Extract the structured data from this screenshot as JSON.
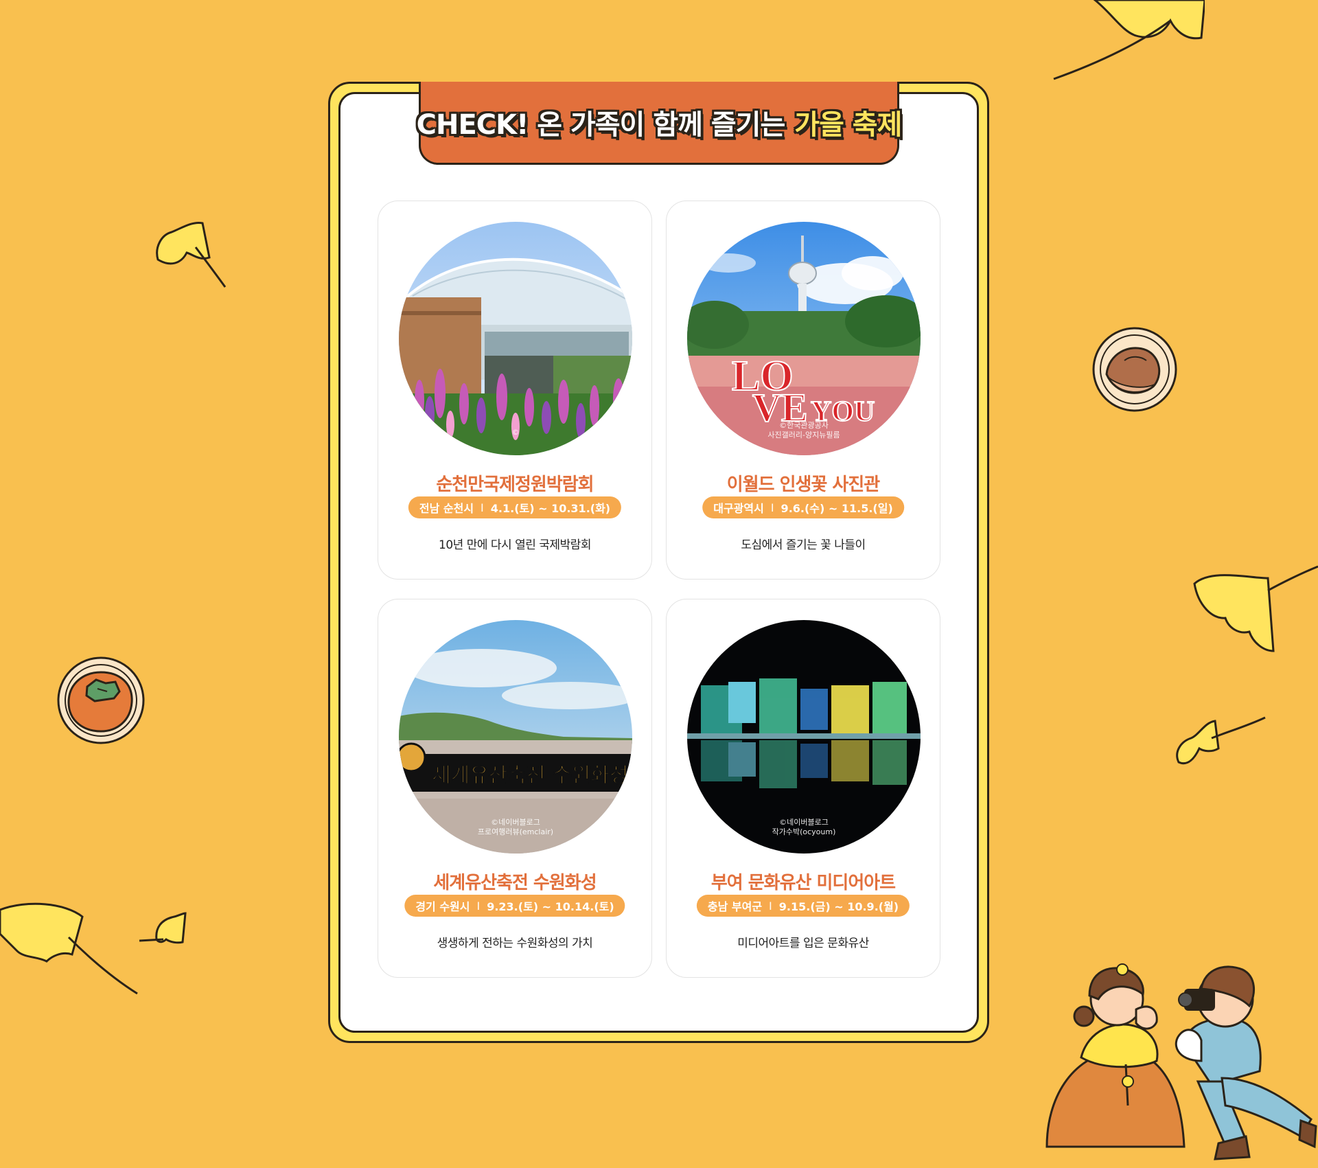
{
  "header": {
    "title_prefix": "CHECK! 온 가족이 함께 즐기는",
    "title_highlight": "가을 축제"
  },
  "cards": [
    {
      "title": "순천만국제정원박람회",
      "region": "전남 순천시",
      "period": "4.1.(토) ~ 10.31.(화)",
      "description": "10년 만에 다시 열린 국제박람회",
      "credit_1": "©",
      "credit_2": ""
    },
    {
      "title": "이월드 인생꽃 사진관",
      "region": "대구광역시",
      "period": "9.6.(수) ~ 11.5.(일)",
      "description": "도심에서 즐기는 꽃 나들이",
      "credit_1": "©한국관광공사",
      "credit_2": "사진갤러리-양지뉴필름",
      "sign_text": "LOVE YOU"
    },
    {
      "title": "세계유산축전 수원화성",
      "region": "경기 수원시",
      "period": "9.23.(토) ~ 10.14.(토)",
      "description": "생생하게 전하는 수원화성의 가치",
      "credit_1": "©네이버블로그",
      "credit_2": "프로여행러뷰(emclair)",
      "sign_text": "세계유산축전 수원화성"
    },
    {
      "title": "부여 문화유산 미디어아트",
      "region": "충남 부여군",
      "period": "9.15.(금) ~ 10.9.(월)",
      "description": "미디어아트를 입은 문화유산",
      "credit_1": "©네이버블로그",
      "credit_2": "작가수박(ocyoum)"
    }
  ],
  "separator": "I",
  "colors": {
    "background": "#F9C04F",
    "panel_frame": "#FFE45E",
    "title_tab": "#E2703C",
    "card_title": "#E2703C",
    "pill": "#F6A94D"
  }
}
